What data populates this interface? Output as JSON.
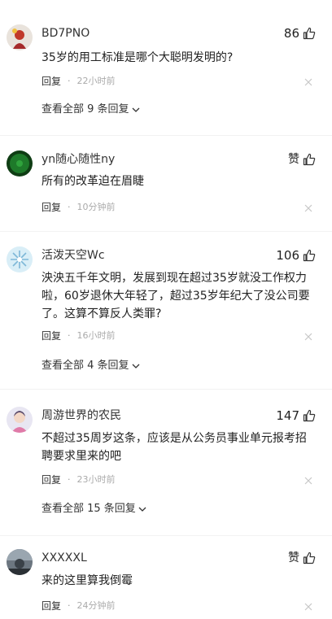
{
  "comments": [
    {
      "username": "BD7PNO",
      "likes": "86",
      "text": "35岁的用工标准是哪个大聪明发明的?",
      "reply_label": "回复",
      "dot": "·",
      "time": "22小时前",
      "more": "查看全部 9 条回复"
    },
    {
      "username": "yn随心随性ny",
      "likes": "赞",
      "text": "所有的改革迫在眉睫",
      "reply_label": "回复",
      "dot": "·",
      "time": "10分钟前"
    },
    {
      "username": "活泼天空Wc",
      "likes": "106",
      "text": "泱泱五千年文明，发展到现在超过35岁就没工作权力啦，60岁退休大年轻了，超过35岁年纪大了没公司要了。这算不算反人类罪?",
      "reply_label": "回复",
      "dot": "·",
      "time": "16小时前",
      "more": "查看全部 4 条回复"
    },
    {
      "username": "周游世界的农民",
      "likes": "147",
      "text": "不超过35周岁这条，应该是从公务员事业单元报考招聘要求里来的吧",
      "reply_label": "回复",
      "dot": "·",
      "time": "23小时前",
      "more": "查看全部 15 条回复"
    },
    {
      "username": "XXXXXL",
      "likes": "赞",
      "text": "来的这里算我倒霉",
      "reply_label": "回复",
      "dot": "·",
      "time": "24分钟前"
    }
  ],
  "colors": {
    "text": "#222222",
    "secondary": "#aaaaaa",
    "divider": "#f2f2f2"
  }
}
